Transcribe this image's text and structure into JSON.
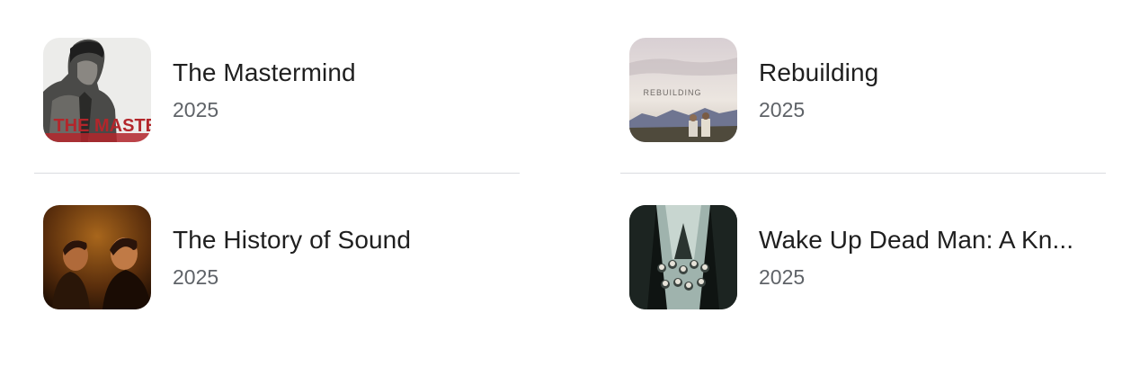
{
  "results": [
    {
      "title": "The Mastermind",
      "year": "2025",
      "poster_text": "THE MASTERMIND",
      "poster_icon": "mastermind-poster"
    },
    {
      "title": "Rebuilding",
      "year": "2025",
      "poster_text": "REBUILDING",
      "poster_icon": "rebuilding-poster"
    },
    {
      "title": "The History of Sound",
      "year": "2025",
      "poster_icon": "history-of-sound-poster"
    },
    {
      "title": "Wake Up Dead Man: A Kn...",
      "year": "2025",
      "poster_icon": "wake-up-dead-man-poster"
    }
  ]
}
